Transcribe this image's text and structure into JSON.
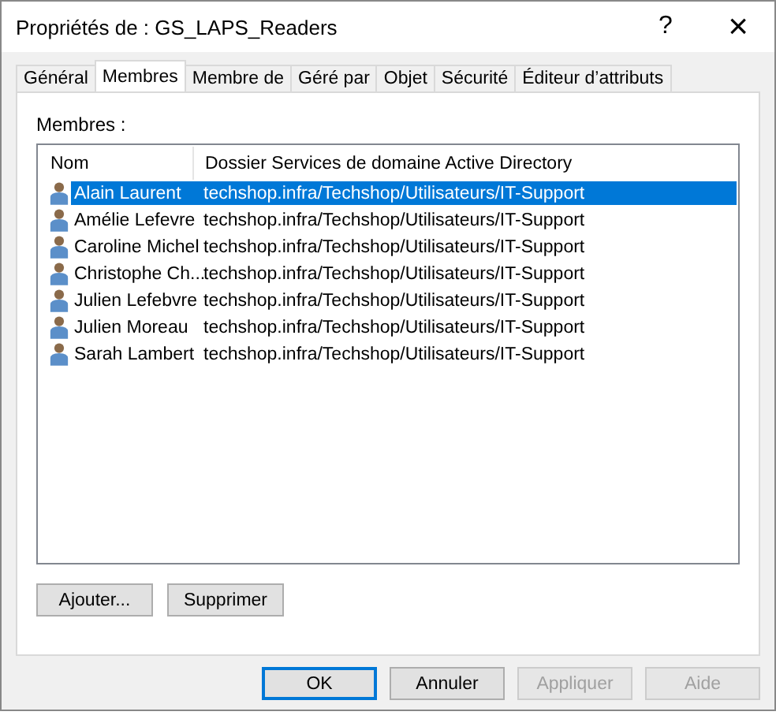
{
  "window": {
    "title": "Propriétés de : GS_LAPS_Readers",
    "help": "?",
    "close": "×"
  },
  "tabs": [
    {
      "label": "Général",
      "selected": false
    },
    {
      "label": "Membres",
      "selected": true
    },
    {
      "label": "Membre de",
      "selected": false
    },
    {
      "label": "Géré par",
      "selected": false
    },
    {
      "label": "Objet",
      "selected": false
    },
    {
      "label": "Sécurité",
      "selected": false
    },
    {
      "label": "Éditeur d’attributs",
      "selected": false
    }
  ],
  "members_label": "Membres :",
  "table": {
    "columns": [
      "Nom",
      "Dossier Services de domaine Active Directory"
    ],
    "rows": [
      {
        "name": "Alain Laurent",
        "folder": "techshop.infra/Techshop/Utilisateurs/IT-Support",
        "selected": true
      },
      {
        "name": "Amélie Lefevre",
        "folder": "techshop.infra/Techshop/Utilisateurs/IT-Support",
        "selected": false
      },
      {
        "name": "Caroline Michel",
        "folder": "techshop.infra/Techshop/Utilisateurs/IT-Support",
        "selected": false
      },
      {
        "name": "Christophe Ch...",
        "folder": "techshop.infra/Techshop/Utilisateurs/IT-Support",
        "selected": false
      },
      {
        "name": "Julien Lefebvre",
        "folder": "techshop.infra/Techshop/Utilisateurs/IT-Support",
        "selected": false
      },
      {
        "name": "Julien Moreau",
        "folder": "techshop.infra/Techshop/Utilisateurs/IT-Support",
        "selected": false
      },
      {
        "name": "Sarah Lambert",
        "folder": "techshop.infra/Techshop/Utilisateurs/IT-Support",
        "selected": false
      }
    ]
  },
  "list_buttons": [
    "Ajouter...",
    "Supprimer"
  ],
  "dialog_buttons": [
    {
      "label": "OK",
      "default": true,
      "disabled": false
    },
    {
      "label": "Annuler",
      "default": false,
      "disabled": false
    },
    {
      "label": "Appliquer",
      "default": false,
      "disabled": true
    },
    {
      "label": "Aide",
      "default": false,
      "disabled": true
    }
  ]
}
